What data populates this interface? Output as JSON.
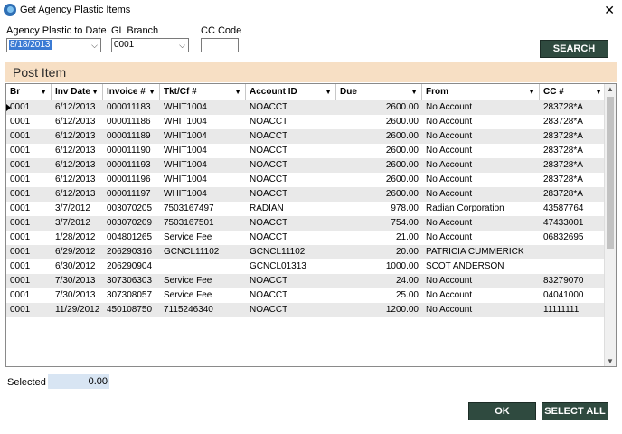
{
  "window": {
    "title": "Get Agency Plastic Items"
  },
  "filters": {
    "agency_plastic_label": "Agency Plastic to Date",
    "agency_plastic_value": "8/18/2013",
    "gl_branch_label": "GL Branch",
    "gl_branch_value": "0001",
    "cc_code_label": "CC Code",
    "cc_code_value": ""
  },
  "buttons": {
    "search": "SEARCH",
    "ok": "OK",
    "select_all": "SELECT ALL"
  },
  "section": {
    "title": "Post Item"
  },
  "table": {
    "columns": [
      "Br",
      "Inv Date",
      "Invoice #",
      "Tkt/Cf #",
      "Account ID",
      "Due",
      "From",
      "CC #"
    ],
    "rows": [
      [
        "0001",
        "6/12/2013",
        "000011183",
        "WHIT1004",
        "NOACCT",
        "2600.00",
        "No Account",
        "283728*A"
      ],
      [
        "0001",
        "6/12/2013",
        "000011186",
        "WHIT1004",
        "NOACCT",
        "2600.00",
        "No Account",
        "283728*A"
      ],
      [
        "0001",
        "6/12/2013",
        "000011189",
        "WHIT1004",
        "NOACCT",
        "2600.00",
        "No Account",
        "283728*A"
      ],
      [
        "0001",
        "6/12/2013",
        "000011190",
        "WHIT1004",
        "NOACCT",
        "2600.00",
        "No Account",
        "283728*A"
      ],
      [
        "0001",
        "6/12/2013",
        "000011193",
        "WHIT1004",
        "NOACCT",
        "2600.00",
        "No Account",
        "283728*A"
      ],
      [
        "0001",
        "6/12/2013",
        "000011196",
        "WHIT1004",
        "NOACCT",
        "2600.00",
        "No Account",
        "283728*A"
      ],
      [
        "0001",
        "6/12/2013",
        "000011197",
        "WHIT1004",
        "NOACCT",
        "2600.00",
        "No Account",
        "283728*A"
      ],
      [
        "0001",
        "3/7/2012",
        "003070205",
        "7503167497",
        "RADIAN",
        "978.00",
        "Radian Corporation",
        "43587764"
      ],
      [
        "0001",
        "3/7/2012",
        "003070209",
        "7503167501",
        "NOACCT",
        "754.00",
        "No Account",
        "47433001"
      ],
      [
        "0001",
        "1/28/2012",
        "004801265",
        "Service Fee",
        "NOACCT",
        "21.00",
        "No Account",
        "06832695"
      ],
      [
        "0001",
        "6/29/2012",
        "206290316",
        "GCNCL11102",
        "GCNCL11102",
        "20.00",
        "PATRICIA CUMMERICK",
        ""
      ],
      [
        "0001",
        "6/30/2012",
        "206290904",
        "",
        "GCNCL01313",
        "1000.00",
        "SCOT ANDERSON",
        ""
      ],
      [
        "0001",
        "7/30/2013",
        "307306303",
        "Service Fee",
        "NOACCT",
        "24.00",
        "No Account",
        "83279070"
      ],
      [
        "0001",
        "7/30/2013",
        "307308057",
        "Service Fee",
        "NOACCT",
        "25.00",
        "No Account",
        "04041000"
      ],
      [
        "0001",
        "11/29/2012",
        "450108750",
        "7115246340",
        "NOACCT",
        "1200.00",
        "No Account",
        "11111111"
      ]
    ]
  },
  "footer": {
    "selected_label": "Selected",
    "selected_value": "0.00"
  },
  "colors": {
    "button": "#2f4a3f",
    "section_header": "#f7dfc4",
    "row_alt": "#e9e9e9",
    "selection": "#3b7bd4"
  }
}
